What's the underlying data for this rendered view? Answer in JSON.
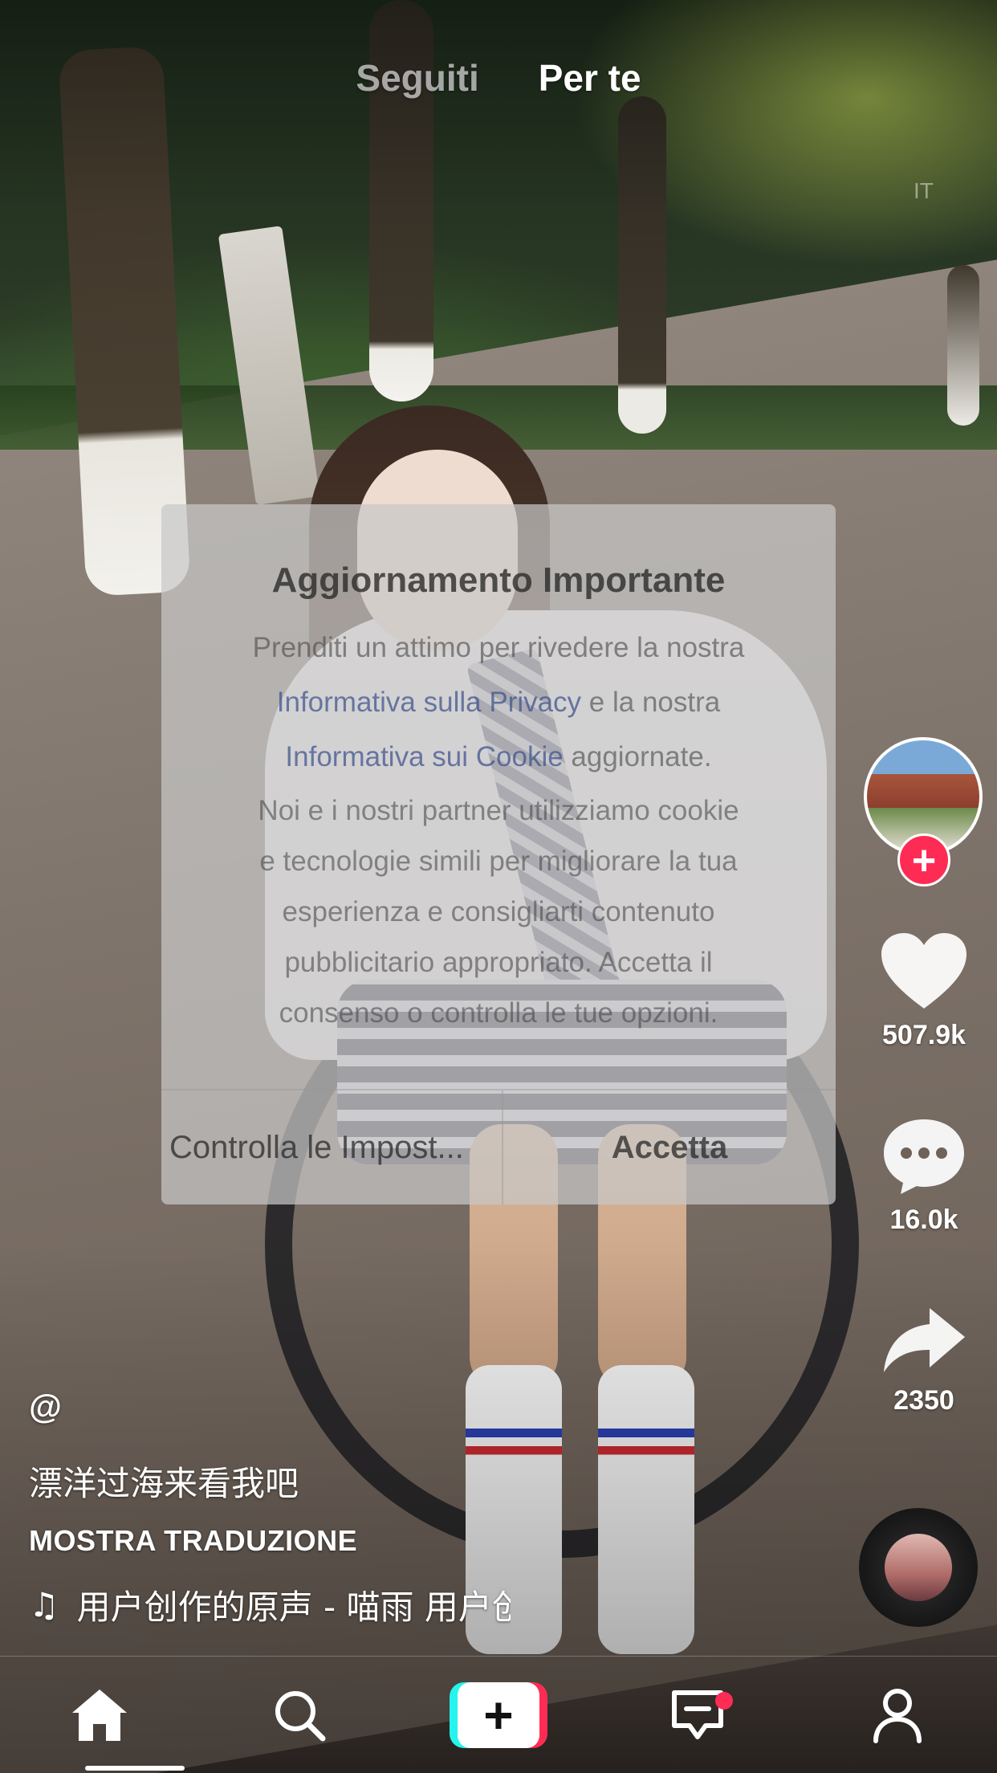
{
  "top_tabs": {
    "following": "Seguiti",
    "for_you": "Per te"
  },
  "lang_badge": "IT",
  "modal": {
    "title": "Aggiornamento Importante",
    "line1": "Prenditi un attimo per rivedere la nostra",
    "privacy_link": "Informativa sulla Privacy",
    "line2_suffix": " e la nostra",
    "cookie_link": "Informativa sui Cookie",
    "line3_suffix": " aggiornate.",
    "desc_lines": [
      "Noi e i nostri partner utilizziamo cookie",
      "e tecnologie simili per migliorare la tua",
      "esperienza e consigliarti contenuto",
      "pubblicitario appropriato. Accetta il",
      "consenso o controlla le tue opzioni."
    ],
    "manage_label": "Controlla le Impost...",
    "accept_label": "Accetta"
  },
  "rail": {
    "follow_symbol": "+",
    "likes": "507.9k",
    "comments": "16.0k",
    "shares": "2350"
  },
  "caption": {
    "username": "@",
    "description": "漂洋过海来看我吧",
    "translate": "MOSTRA TRADUZIONE",
    "music_symbol": "♫",
    "music": "用户创作的原声 - 喵雨    用户创作的原声 - 喵雨"
  },
  "nav": {
    "create_symbol": "+"
  },
  "colors": {
    "accent": "#fe2c55",
    "cyan": "#25f4ee"
  }
}
